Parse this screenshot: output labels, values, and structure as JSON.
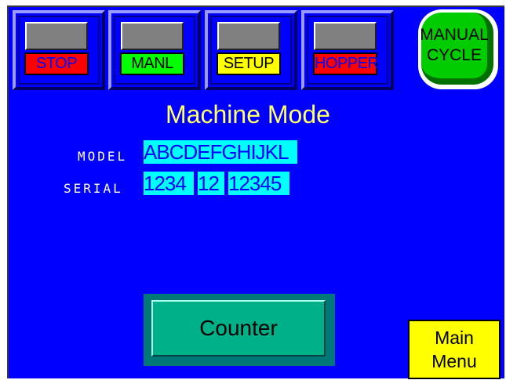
{
  "mode_buttons": [
    {
      "label": "STOP",
      "label_bg": "#ff0000",
      "label_color": "#0000ff"
    },
    {
      "label": "MANL",
      "label_bg": "#00ff00",
      "label_color": "#000000"
    },
    {
      "label": "SETUP",
      "label_bg": "#ffff00",
      "label_color": "#000000"
    },
    {
      "label": "HOPPER",
      "label_bg": "#ff0000",
      "label_color": "#0000ff"
    }
  ],
  "manual_cycle": {
    "line1": "MANUAL",
    "line2": "CYCLE"
  },
  "title": "Machine Mode",
  "model": {
    "label": "MODEL",
    "value": "ABCDEFGHIJKL"
  },
  "serial": {
    "label": "SERIAL",
    "part1": "1234",
    "part2": "12",
    "part3": "12345"
  },
  "counter_button": {
    "label": "Counter"
  },
  "main_menu": {
    "line1": "Main",
    "line2": "Menu"
  },
  "colors": {
    "screen_bg": "#0000ff",
    "title": "#ffff66",
    "field_bg": "#00ffff"
  }
}
